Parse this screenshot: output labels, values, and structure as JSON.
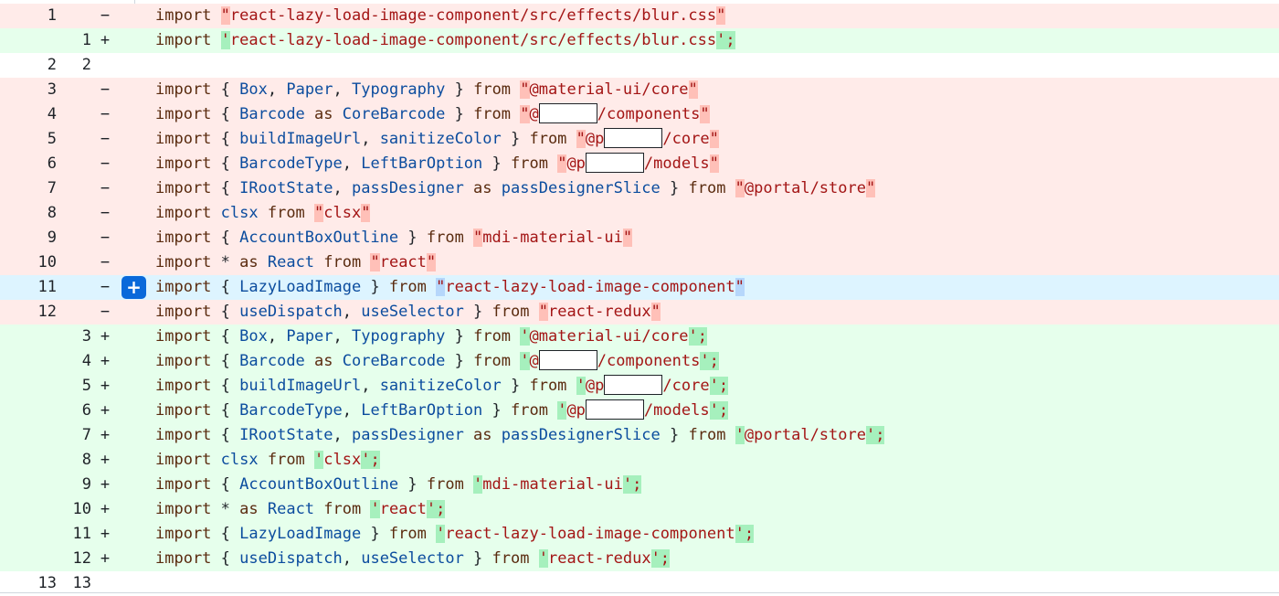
{
  "add_comment_button": {
    "label": "+"
  },
  "rows": [
    {
      "type": "del",
      "old": "1",
      "new": "",
      "sign": "−",
      "tokens": [
        {
          "t": "import ",
          "c": "kw"
        },
        {
          "t": "\"",
          "c": "str q-del"
        },
        {
          "t": "react-lazy-load-image-component/src/effects/blur.css",
          "c": "str"
        },
        {
          "t": "\"",
          "c": "str q-del"
        }
      ]
    },
    {
      "type": "add",
      "old": "",
      "new": "1",
      "sign": "+",
      "tokens": [
        {
          "t": "import ",
          "c": "kw"
        },
        {
          "t": "'",
          "c": "str q-add"
        },
        {
          "t": "react-lazy-load-image-component/src/effects/blur.css",
          "c": "str"
        },
        {
          "t": "';",
          "c": "str q-add"
        }
      ]
    },
    {
      "type": "ctx",
      "old": "2",
      "new": "2",
      "sign": "",
      "tokens": []
    },
    {
      "type": "del",
      "old": "3",
      "new": "",
      "sign": "−",
      "tokens": [
        {
          "t": "import ",
          "c": "kw"
        },
        {
          "t": "{ ",
          "c": "punc"
        },
        {
          "t": "Box",
          "c": "id"
        },
        {
          "t": ", ",
          "c": "punc"
        },
        {
          "t": "Paper",
          "c": "id"
        },
        {
          "t": ", ",
          "c": "punc"
        },
        {
          "t": "Typography",
          "c": "id"
        },
        {
          "t": " } ",
          "c": "punc"
        },
        {
          "t": "from ",
          "c": "kw"
        },
        {
          "t": "\"",
          "c": "str q-del"
        },
        {
          "t": "@material-ui/core",
          "c": "str"
        },
        {
          "t": "\"",
          "c": "str q-del"
        }
      ]
    },
    {
      "type": "del",
      "old": "4",
      "new": "",
      "sign": "−",
      "tokens": [
        {
          "t": "import ",
          "c": "kw"
        },
        {
          "t": "{ ",
          "c": "punc"
        },
        {
          "t": "Barcode",
          "c": "id"
        },
        {
          "t": " as ",
          "c": "kw2"
        },
        {
          "t": "CoreBarcode",
          "c": "id"
        },
        {
          "t": " } ",
          "c": "punc"
        },
        {
          "t": "from ",
          "c": "kw"
        },
        {
          "t": "\"",
          "c": "str q-del"
        },
        {
          "t": "@",
          "c": "str"
        },
        {
          "t": "",
          "c": "redact"
        },
        {
          "t": "/components",
          "c": "str"
        },
        {
          "t": "\"",
          "c": "str q-del"
        }
      ]
    },
    {
      "type": "del",
      "old": "5",
      "new": "",
      "sign": "−",
      "tokens": [
        {
          "t": "import ",
          "c": "kw"
        },
        {
          "t": "{ ",
          "c": "punc"
        },
        {
          "t": "buildImageUrl",
          "c": "id"
        },
        {
          "t": ", ",
          "c": "punc"
        },
        {
          "t": "sanitizeColor",
          "c": "id"
        },
        {
          "t": " } ",
          "c": "punc"
        },
        {
          "t": "from ",
          "c": "kw"
        },
        {
          "t": "\"",
          "c": "str q-del"
        },
        {
          "t": "@p",
          "c": "str"
        },
        {
          "t": "",
          "c": "redact"
        },
        {
          "t": "/core",
          "c": "str"
        },
        {
          "t": "\"",
          "c": "str q-del"
        }
      ]
    },
    {
      "type": "del",
      "old": "6",
      "new": "",
      "sign": "−",
      "tokens": [
        {
          "t": "import ",
          "c": "kw"
        },
        {
          "t": "{ ",
          "c": "punc"
        },
        {
          "t": "BarcodeType",
          "c": "id"
        },
        {
          "t": ", ",
          "c": "punc"
        },
        {
          "t": "LeftBarOption",
          "c": "id"
        },
        {
          "t": " } ",
          "c": "punc"
        },
        {
          "t": "from ",
          "c": "kw"
        },
        {
          "t": "\"",
          "c": "str q-del"
        },
        {
          "t": "@p",
          "c": "str"
        },
        {
          "t": "",
          "c": "redact"
        },
        {
          "t": "/models",
          "c": "str"
        },
        {
          "t": "\"",
          "c": "str q-del"
        }
      ]
    },
    {
      "type": "del",
      "old": "7",
      "new": "",
      "sign": "−",
      "tokens": [
        {
          "t": "import ",
          "c": "kw"
        },
        {
          "t": "{ ",
          "c": "punc"
        },
        {
          "t": "IRootState",
          "c": "id"
        },
        {
          "t": ", ",
          "c": "punc"
        },
        {
          "t": "passDesigner",
          "c": "id"
        },
        {
          "t": " as ",
          "c": "kw2"
        },
        {
          "t": "passDesignerSlice",
          "c": "id"
        },
        {
          "t": " } ",
          "c": "punc"
        },
        {
          "t": "from ",
          "c": "kw"
        },
        {
          "t": "\"",
          "c": "str q-del"
        },
        {
          "t": "@portal/store",
          "c": "str"
        },
        {
          "t": "\"",
          "c": "str q-del"
        }
      ]
    },
    {
      "type": "del",
      "old": "8",
      "new": "",
      "sign": "−",
      "tokens": [
        {
          "t": "import ",
          "c": "kw"
        },
        {
          "t": "clsx",
          "c": "id"
        },
        {
          "t": " from ",
          "c": "kw"
        },
        {
          "t": "\"",
          "c": "str q-del"
        },
        {
          "t": "clsx",
          "c": "str"
        },
        {
          "t": "\"",
          "c": "str q-del"
        }
      ]
    },
    {
      "type": "del",
      "old": "9",
      "new": "",
      "sign": "−",
      "tokens": [
        {
          "t": "import ",
          "c": "kw"
        },
        {
          "t": "{ ",
          "c": "punc"
        },
        {
          "t": "AccountBoxOutline",
          "c": "id"
        },
        {
          "t": " } ",
          "c": "punc"
        },
        {
          "t": "from ",
          "c": "kw"
        },
        {
          "t": "\"",
          "c": "str q-del"
        },
        {
          "t": "mdi-material-ui",
          "c": "str"
        },
        {
          "t": "\"",
          "c": "str q-del"
        }
      ]
    },
    {
      "type": "del",
      "old": "10",
      "new": "",
      "sign": "−",
      "tokens": [
        {
          "t": "import ",
          "c": "kw"
        },
        {
          "t": "* ",
          "c": "punc"
        },
        {
          "t": "as ",
          "c": "kw2"
        },
        {
          "t": "React",
          "c": "id"
        },
        {
          "t": " from ",
          "c": "kw"
        },
        {
          "t": "\"",
          "c": "str q-del"
        },
        {
          "t": "react",
          "c": "str"
        },
        {
          "t": "\"",
          "c": "str q-del"
        }
      ]
    },
    {
      "type": "hl",
      "old": "11",
      "new": "",
      "sign": "−",
      "tokens": [
        {
          "t": "import ",
          "c": "kw"
        },
        {
          "t": "{ ",
          "c": "punc"
        },
        {
          "t": "LazyLoadImage",
          "c": "id"
        },
        {
          "t": " } ",
          "c": "punc"
        },
        {
          "t": "from ",
          "c": "kw"
        },
        {
          "t": "\"",
          "c": "str q-hl"
        },
        {
          "t": "react-lazy-load-image-component",
          "c": "str"
        },
        {
          "t": "\"",
          "c": "str q-hl"
        }
      ]
    },
    {
      "type": "del",
      "old": "12",
      "new": "",
      "sign": "−",
      "tokens": [
        {
          "t": "import ",
          "c": "kw"
        },
        {
          "t": "{ ",
          "c": "punc"
        },
        {
          "t": "useDispatch",
          "c": "id"
        },
        {
          "t": ", ",
          "c": "punc"
        },
        {
          "t": "useSelector",
          "c": "id"
        },
        {
          "t": " } ",
          "c": "punc"
        },
        {
          "t": "from ",
          "c": "kw"
        },
        {
          "t": "\"",
          "c": "str q-del"
        },
        {
          "t": "react-redux",
          "c": "str"
        },
        {
          "t": "\"",
          "c": "str q-del"
        }
      ]
    },
    {
      "type": "add",
      "old": "",
      "new": "3",
      "sign": "+",
      "tokens": [
        {
          "t": "import ",
          "c": "kw"
        },
        {
          "t": "{ ",
          "c": "punc"
        },
        {
          "t": "Box",
          "c": "id"
        },
        {
          "t": ", ",
          "c": "punc"
        },
        {
          "t": "Paper",
          "c": "id"
        },
        {
          "t": ", ",
          "c": "punc"
        },
        {
          "t": "Typography",
          "c": "id"
        },
        {
          "t": " } ",
          "c": "punc"
        },
        {
          "t": "from ",
          "c": "kw"
        },
        {
          "t": "'",
          "c": "str q-add"
        },
        {
          "t": "@material-ui/core",
          "c": "str"
        },
        {
          "t": "';",
          "c": "str q-add"
        }
      ]
    },
    {
      "type": "add",
      "old": "",
      "new": "4",
      "sign": "+",
      "tokens": [
        {
          "t": "import ",
          "c": "kw"
        },
        {
          "t": "{ ",
          "c": "punc"
        },
        {
          "t": "Barcode",
          "c": "id"
        },
        {
          "t": " as ",
          "c": "kw2"
        },
        {
          "t": "CoreBarcode",
          "c": "id"
        },
        {
          "t": " } ",
          "c": "punc"
        },
        {
          "t": "from ",
          "c": "kw"
        },
        {
          "t": "'",
          "c": "str q-add"
        },
        {
          "t": "@",
          "c": "str"
        },
        {
          "t": "",
          "c": "redact"
        },
        {
          "t": "/components",
          "c": "str"
        },
        {
          "t": "';",
          "c": "str q-add"
        }
      ]
    },
    {
      "type": "add",
      "old": "",
      "new": "5",
      "sign": "+",
      "tokens": [
        {
          "t": "import ",
          "c": "kw"
        },
        {
          "t": "{ ",
          "c": "punc"
        },
        {
          "t": "buildImageUrl",
          "c": "id"
        },
        {
          "t": ", ",
          "c": "punc"
        },
        {
          "t": "sanitizeColor",
          "c": "id"
        },
        {
          "t": " } ",
          "c": "punc"
        },
        {
          "t": "from ",
          "c": "kw"
        },
        {
          "t": "'",
          "c": "str q-add"
        },
        {
          "t": "@p",
          "c": "str"
        },
        {
          "t": "",
          "c": "redact"
        },
        {
          "t": "/core",
          "c": "str"
        },
        {
          "t": "';",
          "c": "str q-add"
        }
      ]
    },
    {
      "type": "add",
      "old": "",
      "new": "6",
      "sign": "+",
      "tokens": [
        {
          "t": "import ",
          "c": "kw"
        },
        {
          "t": "{ ",
          "c": "punc"
        },
        {
          "t": "BarcodeType",
          "c": "id"
        },
        {
          "t": ", ",
          "c": "punc"
        },
        {
          "t": "LeftBarOption",
          "c": "id"
        },
        {
          "t": " } ",
          "c": "punc"
        },
        {
          "t": "from ",
          "c": "kw"
        },
        {
          "t": "'",
          "c": "str q-add"
        },
        {
          "t": "@p",
          "c": "str"
        },
        {
          "t": "",
          "c": "redact"
        },
        {
          "t": "/models",
          "c": "str"
        },
        {
          "t": "';",
          "c": "str q-add"
        }
      ]
    },
    {
      "type": "add",
      "old": "",
      "new": "7",
      "sign": "+",
      "tokens": [
        {
          "t": "import ",
          "c": "kw"
        },
        {
          "t": "{ ",
          "c": "punc"
        },
        {
          "t": "IRootState",
          "c": "id"
        },
        {
          "t": ", ",
          "c": "punc"
        },
        {
          "t": "passDesigner",
          "c": "id"
        },
        {
          "t": " as ",
          "c": "kw2"
        },
        {
          "t": "passDesignerSlice",
          "c": "id"
        },
        {
          "t": " } ",
          "c": "punc"
        },
        {
          "t": "from ",
          "c": "kw"
        },
        {
          "t": "'",
          "c": "str q-add"
        },
        {
          "t": "@portal/store",
          "c": "str"
        },
        {
          "t": "';",
          "c": "str q-add"
        }
      ]
    },
    {
      "type": "add",
      "old": "",
      "new": "8",
      "sign": "+",
      "tokens": [
        {
          "t": "import ",
          "c": "kw"
        },
        {
          "t": "clsx",
          "c": "id"
        },
        {
          "t": " from ",
          "c": "kw"
        },
        {
          "t": "'",
          "c": "str q-add"
        },
        {
          "t": "clsx",
          "c": "str"
        },
        {
          "t": "';",
          "c": "str q-add"
        }
      ]
    },
    {
      "type": "add",
      "old": "",
      "new": "9",
      "sign": "+",
      "tokens": [
        {
          "t": "import ",
          "c": "kw"
        },
        {
          "t": "{ ",
          "c": "punc"
        },
        {
          "t": "AccountBoxOutline",
          "c": "id"
        },
        {
          "t": " } ",
          "c": "punc"
        },
        {
          "t": "from ",
          "c": "kw"
        },
        {
          "t": "'",
          "c": "str q-add"
        },
        {
          "t": "mdi-material-ui",
          "c": "str"
        },
        {
          "t": "';",
          "c": "str q-add"
        }
      ]
    },
    {
      "type": "add",
      "old": "",
      "new": "10",
      "sign": "+",
      "tokens": [
        {
          "t": "import ",
          "c": "kw"
        },
        {
          "t": "* ",
          "c": "punc"
        },
        {
          "t": "as ",
          "c": "kw2"
        },
        {
          "t": "React",
          "c": "id"
        },
        {
          "t": " from ",
          "c": "kw"
        },
        {
          "t": "'",
          "c": "str q-add"
        },
        {
          "t": "react",
          "c": "str"
        },
        {
          "t": "';",
          "c": "str q-add"
        }
      ]
    },
    {
      "type": "add",
      "old": "",
      "new": "11",
      "sign": "+",
      "tokens": [
        {
          "t": "import ",
          "c": "kw"
        },
        {
          "t": "{ ",
          "c": "punc"
        },
        {
          "t": "LazyLoadImage",
          "c": "id"
        },
        {
          "t": " } ",
          "c": "punc"
        },
        {
          "t": "from ",
          "c": "kw"
        },
        {
          "t": "'",
          "c": "str q-add"
        },
        {
          "t": "react-lazy-load-image-component",
          "c": "str"
        },
        {
          "t": "';",
          "c": "str q-add"
        }
      ]
    },
    {
      "type": "add",
      "old": "",
      "new": "12",
      "sign": "+",
      "tokens": [
        {
          "t": "import ",
          "c": "kw"
        },
        {
          "t": "{ ",
          "c": "punc"
        },
        {
          "t": "useDispatch",
          "c": "id"
        },
        {
          "t": ", ",
          "c": "punc"
        },
        {
          "t": "useSelector",
          "c": "id"
        },
        {
          "t": " } ",
          "c": "punc"
        },
        {
          "t": "from ",
          "c": "kw"
        },
        {
          "t": "'",
          "c": "str q-add"
        },
        {
          "t": "react-redux",
          "c": "str"
        },
        {
          "t": "';",
          "c": "str q-add"
        }
      ]
    },
    {
      "type": "ctx",
      "old": "13",
      "new": "13",
      "sign": "",
      "tokens": []
    }
  ]
}
